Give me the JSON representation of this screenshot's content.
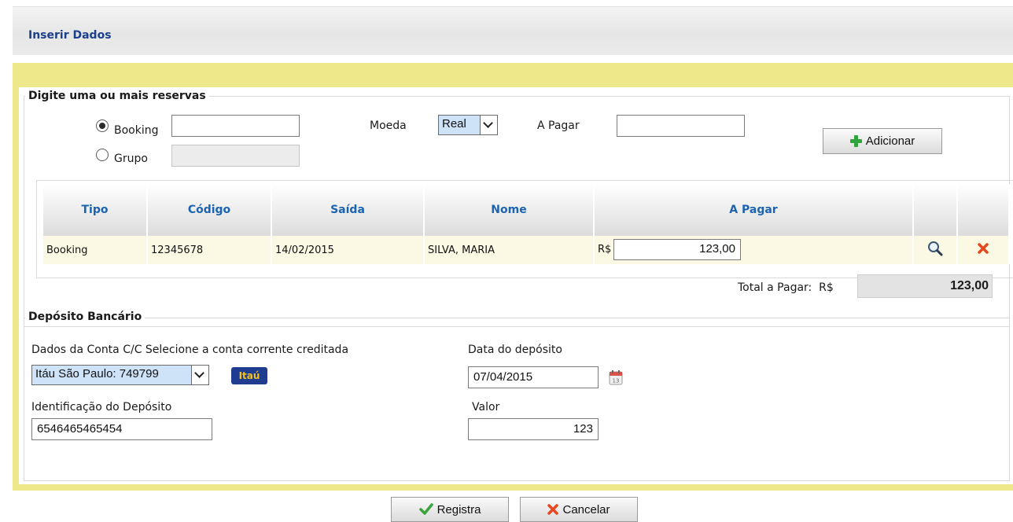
{
  "header": {
    "title": "Inserir Dados"
  },
  "reservas": {
    "legend": "Digite uma ou mais reservas",
    "booking_label": "Booking",
    "booking_value": "",
    "grupo_label": "Grupo",
    "grupo_value": "",
    "moeda_label": "Moeda",
    "moeda_value": "Real",
    "apagar_label": "A Pagar",
    "apagar_value": "",
    "add_button": "Adicionar"
  },
  "table": {
    "headers": [
      "Tipo",
      "Código",
      "Saída",
      "Nome",
      "A Pagar"
    ],
    "rows": [
      {
        "tipo": "Booking",
        "codigo": "12345678",
        "saida": "14/02/2015",
        "nome": "SILVA, MARIA",
        "currency": "R$",
        "valor": "123,00"
      }
    ]
  },
  "total": {
    "label": "Total a Pagar:",
    "currency": "R$",
    "value": "123,00"
  },
  "deposito": {
    "legend": "Depósito Bancário",
    "conta_label": "Dados da Conta C/C Selecione a conta corrente creditada",
    "conta_value": "Itáu São Paulo: 749799",
    "bank_logo": "Itaú",
    "data_label": "Data do depósito",
    "data_value": "07/04/2015",
    "ident_label": "Identificação do Depósito",
    "ident_value": "6546465465454",
    "valor_label": "Valor",
    "valor_value": "123"
  },
  "actions": {
    "registra": "Registra",
    "cancelar": "Cancelar"
  },
  "colors": {
    "accent_blue": "#1c3f8c",
    "header_blue": "#1c63b0",
    "panel_yellow": "#efe88a",
    "plus_green": "#2fa33c",
    "cancel_red": "#e5481e"
  }
}
